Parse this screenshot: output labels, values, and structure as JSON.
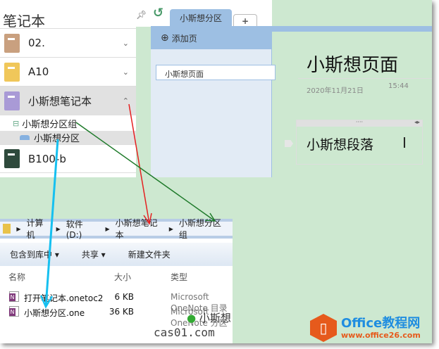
{
  "notebooks_panel": {
    "title": "笔记本",
    "notebooks": [
      {
        "label": "02.",
        "color": "#c9a07f",
        "state": "collapsed"
      },
      {
        "label": "A10",
        "color": "#f0c75a",
        "state": "collapsed"
      },
      {
        "label": "小斯想笔记本",
        "color": "#a99ad6",
        "state": "expanded"
      },
      {
        "label": "B100-b",
        "color": "#2e4a3c",
        "state": "collapsed"
      }
    ],
    "section_group": "小斯想分区组",
    "section": "小斯想分区"
  },
  "tabs": {
    "active": "小斯想分区",
    "add": "+"
  },
  "page_list": {
    "add_page": "添加页",
    "pages": [
      "小斯想页面"
    ]
  },
  "page": {
    "title": "小斯想页面",
    "date": "2020年11月21日",
    "time": "15:44",
    "paragraph": "小斯想段落"
  },
  "explorer": {
    "breadcrumb": [
      "计算机",
      "软件 (D:)",
      "小斯想笔记本",
      "小斯想分区组"
    ],
    "toolbar": [
      "包含到库中 ▾",
      "共享 ▾",
      "新建文件夹"
    ],
    "columns": [
      "名称",
      "大小",
      "类型"
    ],
    "files": [
      {
        "name": "打开笔记本.onetoc2",
        "size": "6 KB",
        "type": "Microsoft OneNote 目录"
      },
      {
        "name": "小斯想分区.one",
        "size": "36 KB",
        "type": "Microsoft OneNote 分区"
      }
    ]
  },
  "watermark": {
    "wechat": "小斯想",
    "site": "cas01.com"
  },
  "logo": {
    "name": "Office教程网",
    "url": "www.office26.com"
  }
}
